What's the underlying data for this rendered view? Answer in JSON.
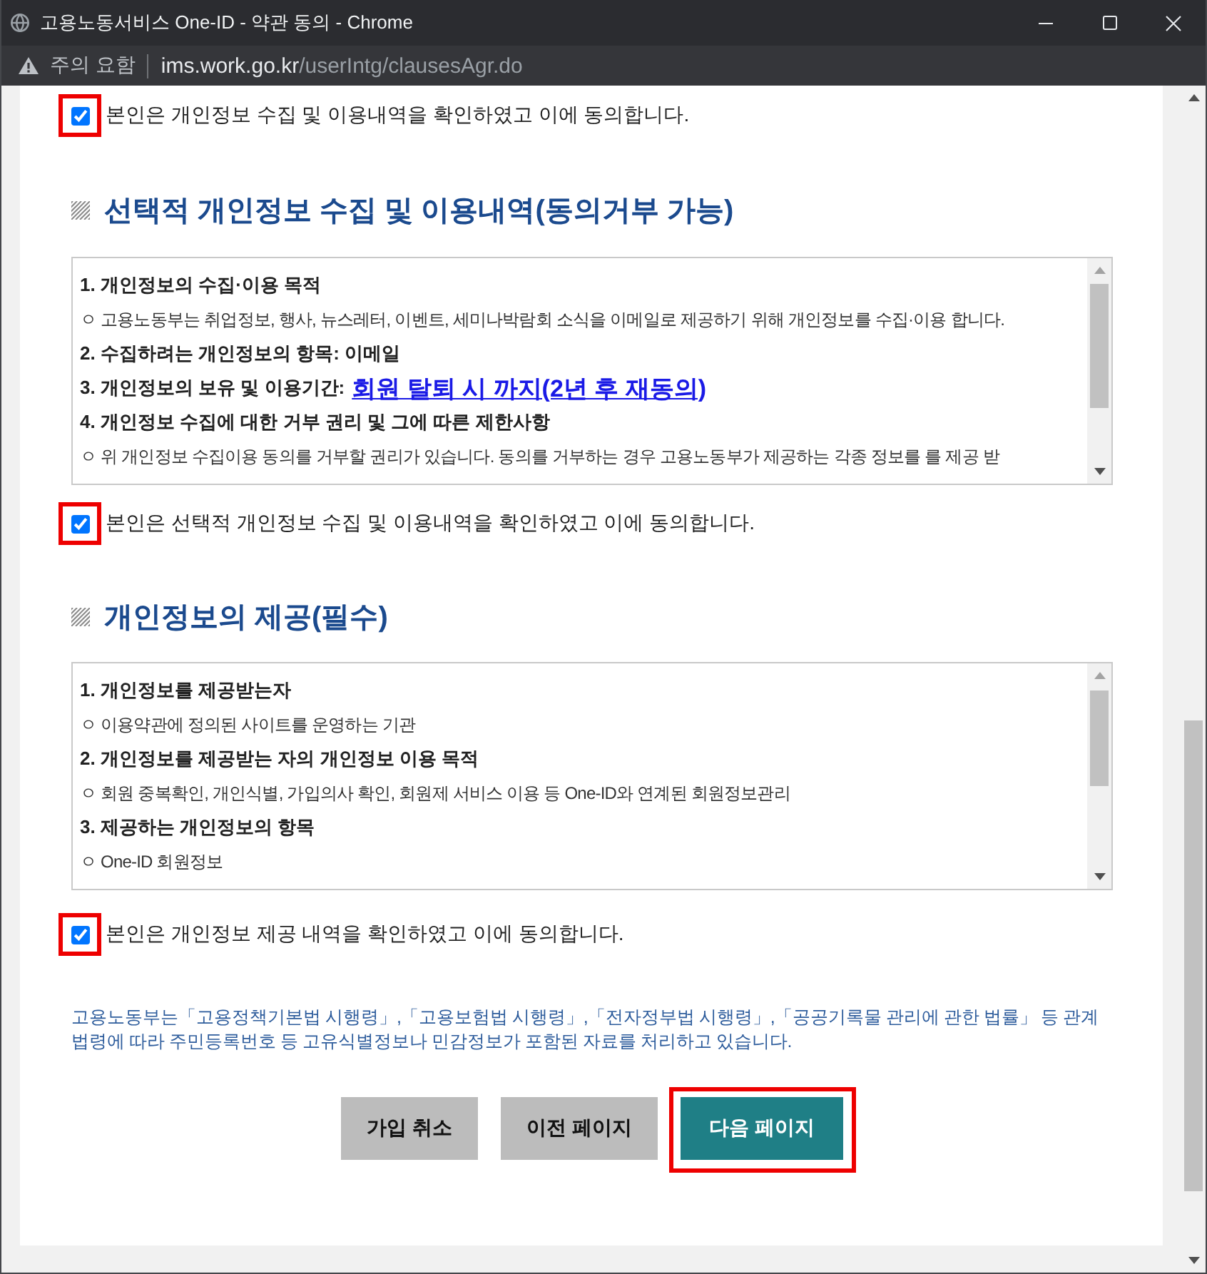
{
  "window": {
    "title": "고용노동서비스 One-ID - 약관 동의 - Chrome"
  },
  "address_bar": {
    "security_label": "주의 요함",
    "host": "ims.work.go.kr",
    "path": "/userIntg/clausesAgr.do"
  },
  "top_consent": {
    "label": "본인은 개인정보 수집 및 이용내역을 확인하였고 이에 동의합니다.",
    "checked": true,
    "highlighted": true
  },
  "sections": [
    {
      "heading": "선택적 개인정보 수집 및 이용내역(동의거부 가능)",
      "terms": [
        {
          "kind": "title",
          "text": "1. 개인정보의 수집·이용 목적"
        },
        {
          "kind": "bullet",
          "text": "ㅇ 고용노동부는 취업정보, 행사, 뉴스레터, 이벤트, 세미나박람회 소식을 이메일로 제공하기 위해 개인정보를 수집·이용 합니다."
        },
        {
          "kind": "title",
          "text": "2. 수집하려는 개인정보의 항목: 이메일"
        },
        {
          "kind": "title",
          "text": "3. 개인정보의 보유 및 이용기간:",
          "emphasis": "회원 탈퇴 시 까지(2년 후 재동의)"
        },
        {
          "kind": "title",
          "text": "4. 개인정보 수집에 대한 거부 권리 및 그에 따른 제한사항"
        },
        {
          "kind": "bullet",
          "text": "ㅇ 위 개인정보 수집이용 동의를 거부할 권리가 있습니다. 동의를 거부하는 경우 고용노동부가 제공하는 각종 정보를 를 제공 받"
        }
      ],
      "consent": {
        "label": "본인은 선택적 개인정보 수집 및 이용내역을 확인하였고 이에 동의합니다.",
        "checked": true,
        "highlighted": true
      }
    },
    {
      "heading": "개인정보의 제공(필수)",
      "terms": [
        {
          "kind": "title",
          "text": "1. 개인정보를 제공받는자"
        },
        {
          "kind": "bullet",
          "text": "ㅇ 이용약관에 정의된 사이트를 운영하는 기관"
        },
        {
          "kind": "title",
          "text": "2. 개인정보를 제공받는 자의 개인정보 이용 목적"
        },
        {
          "kind": "bullet",
          "text": "ㅇ 회원 중복확인, 개인식별, 가입의사 확인, 회원제 서비스 이용 등 One-ID와 연계된 회원정보관리"
        },
        {
          "kind": "title",
          "text": "3. 제공하는 개인정보의 항목"
        },
        {
          "kind": "bullet",
          "text": "ㅇ One-ID 회원정보"
        }
      ],
      "consent": {
        "label": "본인은 개인정보 제공 내역을 확인하였고 이에 동의합니다.",
        "checked": true,
        "highlighted": true
      }
    }
  ],
  "notice": "고용노동부는「고용정책기본법 시행령」,「고용보험법 시행령」,「전자정부법 시행령」,「공공기록물 관리에 관한 법률」 등 관계 법령에 따라 주민등록번호 등 고유식별정보나 민감정보가 포함된 자료를 처리하고 있습니다.",
  "buttons": [
    {
      "label": "가입 취소",
      "kind": "secondary",
      "highlighted": false
    },
    {
      "label": "이전 페이지",
      "kind": "secondary",
      "highlighted": false
    },
    {
      "label": "다음 페이지",
      "kind": "primary",
      "highlighted": true
    }
  ]
}
